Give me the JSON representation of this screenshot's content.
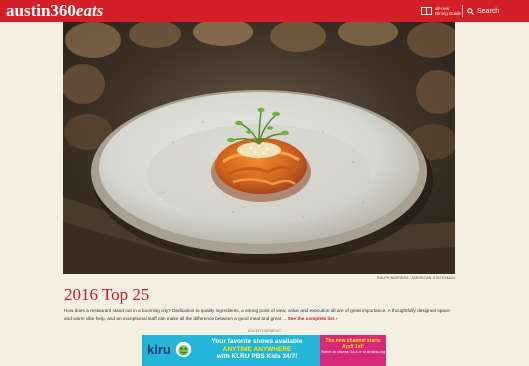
{
  "header": {
    "logo_main": "austin360",
    "logo_accent": "eats",
    "dining_guide": "all-new Dining Guide",
    "search_label": "Search",
    "bar_color": "#d51f26"
  },
  "hero": {
    "photo_credit": "RALPH BARRERA / AMERICAN-STATESMAN",
    "plate_color": "#e3e4de",
    "food_color": "#d2681e"
  },
  "article": {
    "title": "2016 Top 25",
    "description": "How does a restaurant stand out in a booming city? Dedication to quality ingredients, a strong point of view, value and execution all are of great importance. A thoughtfully designed space and warm vibe help, and an exceptional staff can make all the difference between a good meal and great ...",
    "link_text": "See the complete list ›",
    "accent_color": "#c8202a"
  },
  "ad": {
    "label": "ADVERTISEMENT",
    "brand": "klru",
    "line1": "Your favorite shows available",
    "line2": "ANYTIME ANYWHERE",
    "line3": "with KLRU PBS Kids 24/7!",
    "right_line1": "The new channel starts April 1st!",
    "right_line2": "Watch on channel 18.4 or at klrukids.org"
  }
}
